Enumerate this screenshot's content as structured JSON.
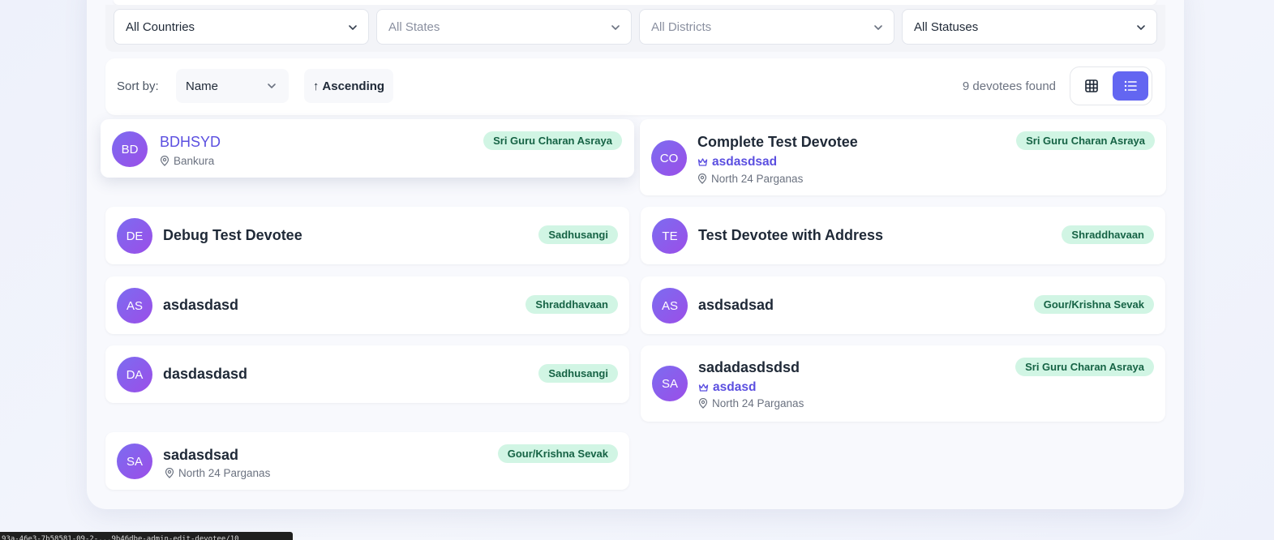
{
  "filters": {
    "country": "All Countries",
    "state": "All States",
    "district": "All Districts",
    "status": "All Statuses"
  },
  "sort": {
    "label": "Sort by:",
    "field": "Name",
    "direction": "Ascending",
    "direction_arrow": "↑"
  },
  "results": {
    "count_text": "9 devotees found",
    "view_mode": "list"
  },
  "devotees": [
    {
      "initials": "BD",
      "name": "BDHSYD",
      "badge": "Sri Guru Charan Asraya",
      "location": "Bankura"
    },
    {
      "initials": "CO",
      "name": "Complete Test Devotee",
      "badge": "Sri Guru Charan Asraya",
      "mentor": "asdasdsad",
      "location": "North 24 Parganas"
    },
    {
      "initials": "DE",
      "name": "Debug Test Devotee",
      "badge": "Sadhusangi"
    },
    {
      "initials": "TE",
      "name": "Test Devotee with Address",
      "badge": "Shraddhavaan"
    },
    {
      "initials": "AS",
      "name": "asdasdasd",
      "badge": "Shraddhavaan"
    },
    {
      "initials": "AS",
      "name": "asdsadsad",
      "badge": "Gour/Krishna Sevak"
    },
    {
      "initials": "DA",
      "name": "dasdasdasd",
      "badge": "Sadhusangi"
    },
    {
      "initials": "SA",
      "name": "sadadasdsdsd",
      "badge": "Sri Guru Charan Asraya",
      "mentor": "asdasd",
      "location": "North 24 Parganas"
    },
    {
      "initials": "SA",
      "name": "sadasdsad",
      "badge": "Gour/Krishna Sevak",
      "location": "North 24 Parganas"
    }
  ],
  "status_bar": {
    "url": "93a-46e3-7b58581-09-2-...9b46dbe-admin-edit-devotee/10"
  },
  "icons": {
    "chevron": "chevron-down-icon",
    "location": "map-pin-icon",
    "mentor": "crown-icon",
    "grid": "grid-icon",
    "list": "list-icon"
  },
  "colors": {
    "accent": "#6366f1",
    "badge_bg": "#d1f5e4",
    "badge_text": "#166345",
    "avatar_from": "#7c6cf0",
    "avatar_to": "#9b4ee8"
  }
}
